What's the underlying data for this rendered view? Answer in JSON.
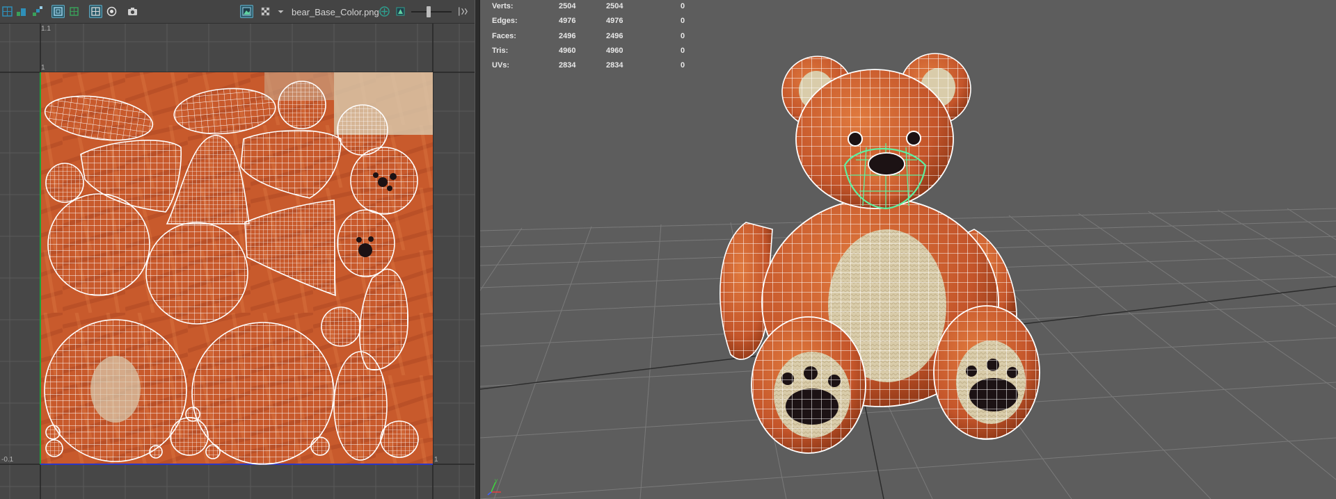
{
  "uv_editor": {
    "texture_name": "bear_Base_Color.png",
    "exposure_slider": 0.42,
    "toolbar_icons": [
      "uv-shell-icon",
      "uv-layout-icon",
      "uv-distort-icon",
      "wireframe-toggle-icon",
      "checker-icon",
      "grid-toggle-icon",
      "filter-icon",
      "snapshot-icon",
      "image-display-icon",
      "checker-display-icon",
      "dropdown-arrow-icon",
      "exposure-icon",
      "gamma-icon",
      "slider-end-icon"
    ],
    "tick_labels": {
      "top_left": "1.1",
      "upper_left": "1",
      "lower_left": "-0.1",
      "lower_right": "1"
    },
    "colors": {
      "uv_wire": "#ffffff",
      "u_axis": "#2b37c4",
      "v_axis": "#1ca33a",
      "texture_orange": "#c4552a"
    }
  },
  "viewport": {
    "hud": {
      "rows": [
        {
          "label": "Verts:",
          "v1": "2504",
          "v2": "2504",
          "v3": "0"
        },
        {
          "label": "Edges:",
          "v1": "4976",
          "v2": "4976",
          "v3": "0"
        },
        {
          "label": "Faces:",
          "v1": "2496",
          "v2": "2496",
          "v3": "0"
        },
        {
          "label": "Tris:",
          "v1": "4960",
          "v2": "4960",
          "v3": "0"
        },
        {
          "label": "UVs:",
          "v1": "2834",
          "v2": "2834",
          "v3": "0"
        }
      ]
    },
    "axis": {
      "x": "x",
      "y": "y",
      "z": "z"
    },
    "colors": {
      "background": "#5d5d5d",
      "grid": "#7a7a7a",
      "selection": "#5ef0a0",
      "fur": "#c4552a",
      "belly": "#d8c9a3"
    }
  }
}
